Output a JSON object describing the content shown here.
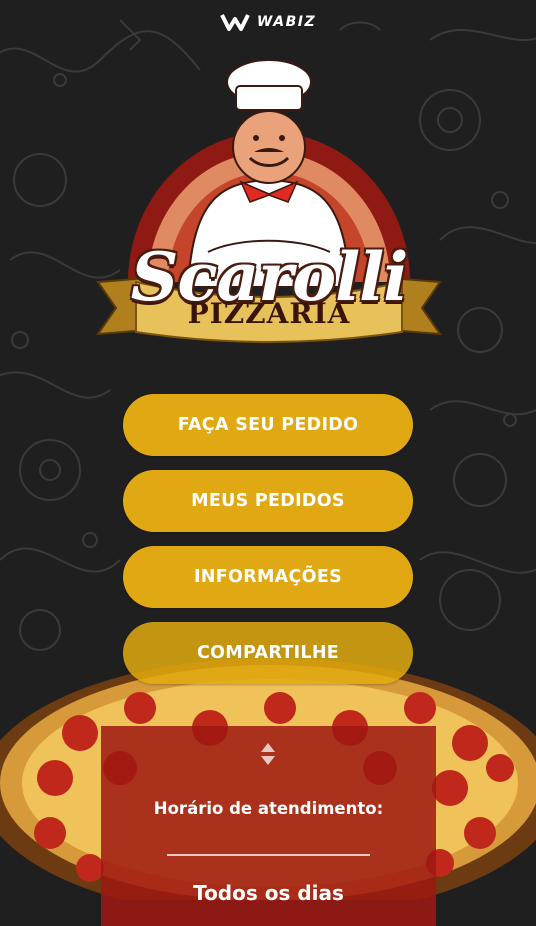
{
  "brand": {
    "name": "WABIZ",
    "icon": "wabiz-logo-icon"
  },
  "logo": {
    "title": "Scarolli",
    "subtitle": "PIZZARIA",
    "icon": "chef-mascot-icon"
  },
  "menu": {
    "items": [
      {
        "label": "FAÇA SEU PEDIDO"
      },
      {
        "label": "MEUS PEDIDOS"
      },
      {
        "label": "INFORMAÇÕES"
      },
      {
        "label": "COMPARTILHE"
      }
    ]
  },
  "hours": {
    "icon": "sort-arrows-icon",
    "label": "Horário de atendimento:",
    "days": "Todos os dias"
  },
  "colors": {
    "background": "#1f1f1f",
    "button": "#e0a812",
    "panel": "#9e1812",
    "text": "#ffffff"
  }
}
